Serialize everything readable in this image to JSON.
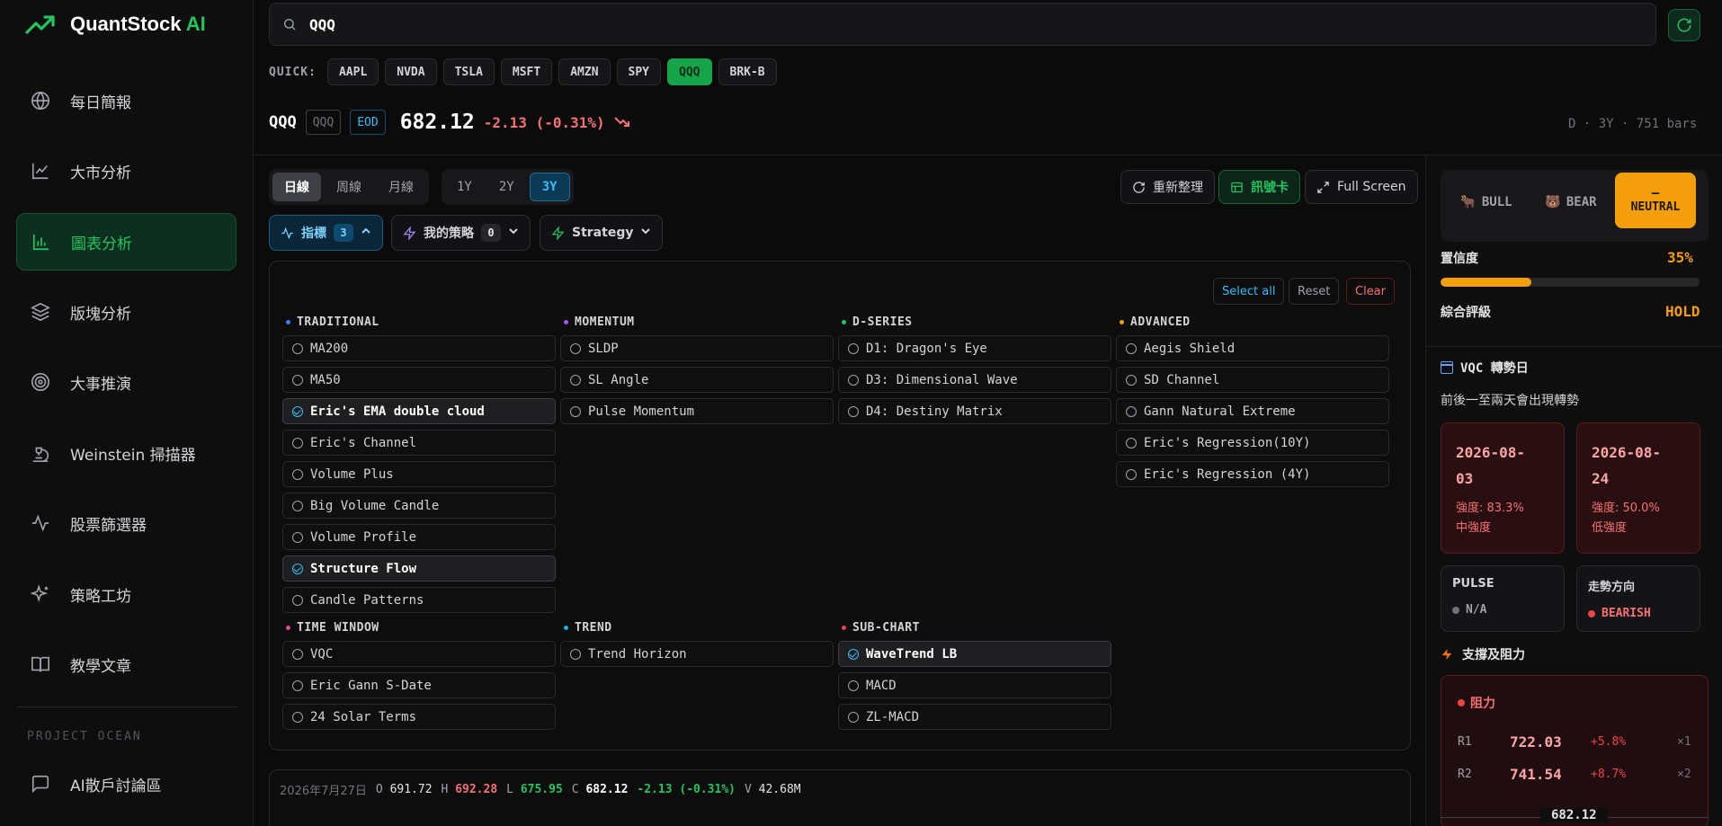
{
  "brand": {
    "name": "QuantStock",
    "suffix": "AI",
    "accent": "#22c55e"
  },
  "sidebar": {
    "items": [
      {
        "label": "每日簡報",
        "icon": "globe-icon"
      },
      {
        "label": "大市分析",
        "icon": "line-chart-icon"
      },
      {
        "label": "圖表分析",
        "icon": "bar-chart-icon",
        "active": true
      },
      {
        "label": "版塊分析",
        "icon": "layers-icon"
      },
      {
        "label": "大事推演",
        "icon": "target-icon"
      },
      {
        "label": "Weinstein 掃描器",
        "icon": "microscope-icon"
      },
      {
        "label": "股票篩選器",
        "icon": "pulse-icon"
      },
      {
        "label": "策略工坊",
        "icon": "sparkles-icon"
      },
      {
        "label": "教學文章",
        "icon": "book-icon"
      }
    ],
    "section_label": "PROJECT OCEAN",
    "section_items": [
      {
        "label": "AI散戶討論區",
        "icon": "chat-icon"
      }
    ]
  },
  "search": {
    "value": "QQQ",
    "placeholder": ""
  },
  "quick": {
    "label": "QUICK:",
    "symbols": [
      "AAPL",
      "NVDA",
      "TSLA",
      "MSFT",
      "AMZN",
      "SPY",
      "QQQ",
      "BRK-B"
    ],
    "active": "QQQ"
  },
  "ticker": {
    "symbol": "QQQ",
    "code": "QQQ",
    "source": "EOD",
    "price": "682.12",
    "change": "-2.13 (-0.31%)",
    "meta": "D · 3Y · 751 bars"
  },
  "controls": {
    "intervals": [
      "日線",
      "周線",
      "月線"
    ],
    "active_interval": "日線",
    "ranges": [
      "1Y",
      "2Y",
      "3Y"
    ],
    "active_range": "3Y",
    "reorganize": "重新整理",
    "signal_card": "訊號卡",
    "full_screen": "Full Screen",
    "indicators_label": "指標",
    "indicators_count": "3",
    "my_strategy_label": "我的策略",
    "my_strategy_count": "0",
    "strategy_label": "Strategy"
  },
  "panel": {
    "select_all": "Select all",
    "reset": "Reset",
    "clear": "Clear",
    "groups": [
      {
        "title": "TRADITIONAL",
        "color": "#3b82f6",
        "items": [
          {
            "label": "MA200",
            "on": false
          },
          {
            "label": "MA50",
            "on": false
          },
          {
            "label": "Eric's EMA double cloud",
            "on": true
          },
          {
            "label": "Eric's Channel",
            "on": false
          },
          {
            "label": "Volume Plus",
            "on": false
          },
          {
            "label": "Big Volume Candle",
            "on": false
          },
          {
            "label": "Volume Profile",
            "on": false
          },
          {
            "label": "Structure Flow",
            "on": true
          },
          {
            "label": "Candle Patterns",
            "on": false
          }
        ]
      },
      {
        "title": "MOMENTUM",
        "color": "#a855f7",
        "items": [
          {
            "label": "SLDP",
            "on": false
          },
          {
            "label": "SL Angle",
            "on": false
          },
          {
            "label": "Pulse Momentum",
            "on": false
          }
        ]
      },
      {
        "title": "D-SERIES",
        "color": "#22c55e",
        "items": [
          {
            "label": "D1: Dragon's Eye",
            "on": false
          },
          {
            "label": "D3: Dimensional Wave",
            "on": false
          },
          {
            "label": "D4: Destiny Matrix",
            "on": false
          }
        ]
      },
      {
        "title": "ADVANCED",
        "color": "#f59e0b",
        "items": [
          {
            "label": "Aegis Shield",
            "on": false
          },
          {
            "label": "SD Channel",
            "on": false
          },
          {
            "label": "Gann Natural Extreme",
            "on": false
          },
          {
            "label": "Eric's Regression(10Y)",
            "on": false
          },
          {
            "label": "Eric's Regression (4Y)",
            "on": false
          }
        ]
      },
      {
        "title": "TIME WINDOW",
        "color": "#ec4899",
        "items": [
          {
            "label": "VQC",
            "on": false
          },
          {
            "label": "Eric Gann S-Date",
            "on": false
          },
          {
            "label": "24 Solar Terms",
            "on": false
          }
        ]
      },
      {
        "title": "TREND",
        "color": "#06b6d4",
        "items": [
          {
            "label": "Trend Horizon",
            "on": false
          }
        ]
      },
      {
        "title": "SUB-CHART",
        "color": "#f43f5e",
        "items": [
          {
            "label": "WaveTrend LB",
            "on": true
          },
          {
            "label": "MACD",
            "on": false
          },
          {
            "label": "ZL-MACD",
            "on": false
          }
        ]
      }
    ]
  },
  "ohlc": {
    "date": "2026年7月27日",
    "o_label": "O",
    "o": "691.72",
    "h_label": "H",
    "h": "692.28",
    "l_label": "L",
    "l": "675.95",
    "c_label": "C",
    "c": "682.12",
    "chg": "-2.13 (-0.31%)",
    "v_label": "V",
    "v": "42.68M"
  },
  "right": {
    "bull": "BULL",
    "bear": "BEAR",
    "neutral": "NEUTRAL",
    "confidence_label": "置信度",
    "confidence": "35%",
    "confidence_fraction": 0.35,
    "rating_label": "綜合評級",
    "rating": "HOLD",
    "vqc_title": "VQC 轉勢日",
    "vqc_sub": "前後一至兩天會出現轉勢",
    "dates": [
      {
        "date_a": "2026-08-",
        "date_b": "03",
        "strength": "強度: 83.3%",
        "level": "中強度"
      },
      {
        "date_a": "2026-08-",
        "date_b": "24",
        "strength": "強度: 50.0%",
        "level": "低強度"
      }
    ],
    "pulse_label": "PULSE",
    "pulse_value": "N/A",
    "direction_label": "走勢方向",
    "direction_value": "BEARISH",
    "sr_title": "支撐及阻力",
    "resistance_label": "阻力",
    "resistance": [
      {
        "k": "R1",
        "price": "722.03",
        "pct": "+5.8%",
        "x": "×1"
      },
      {
        "k": "R2",
        "price": "741.54",
        "pct": "+8.7%",
        "x": "×2"
      }
    ],
    "current": "682.12"
  }
}
